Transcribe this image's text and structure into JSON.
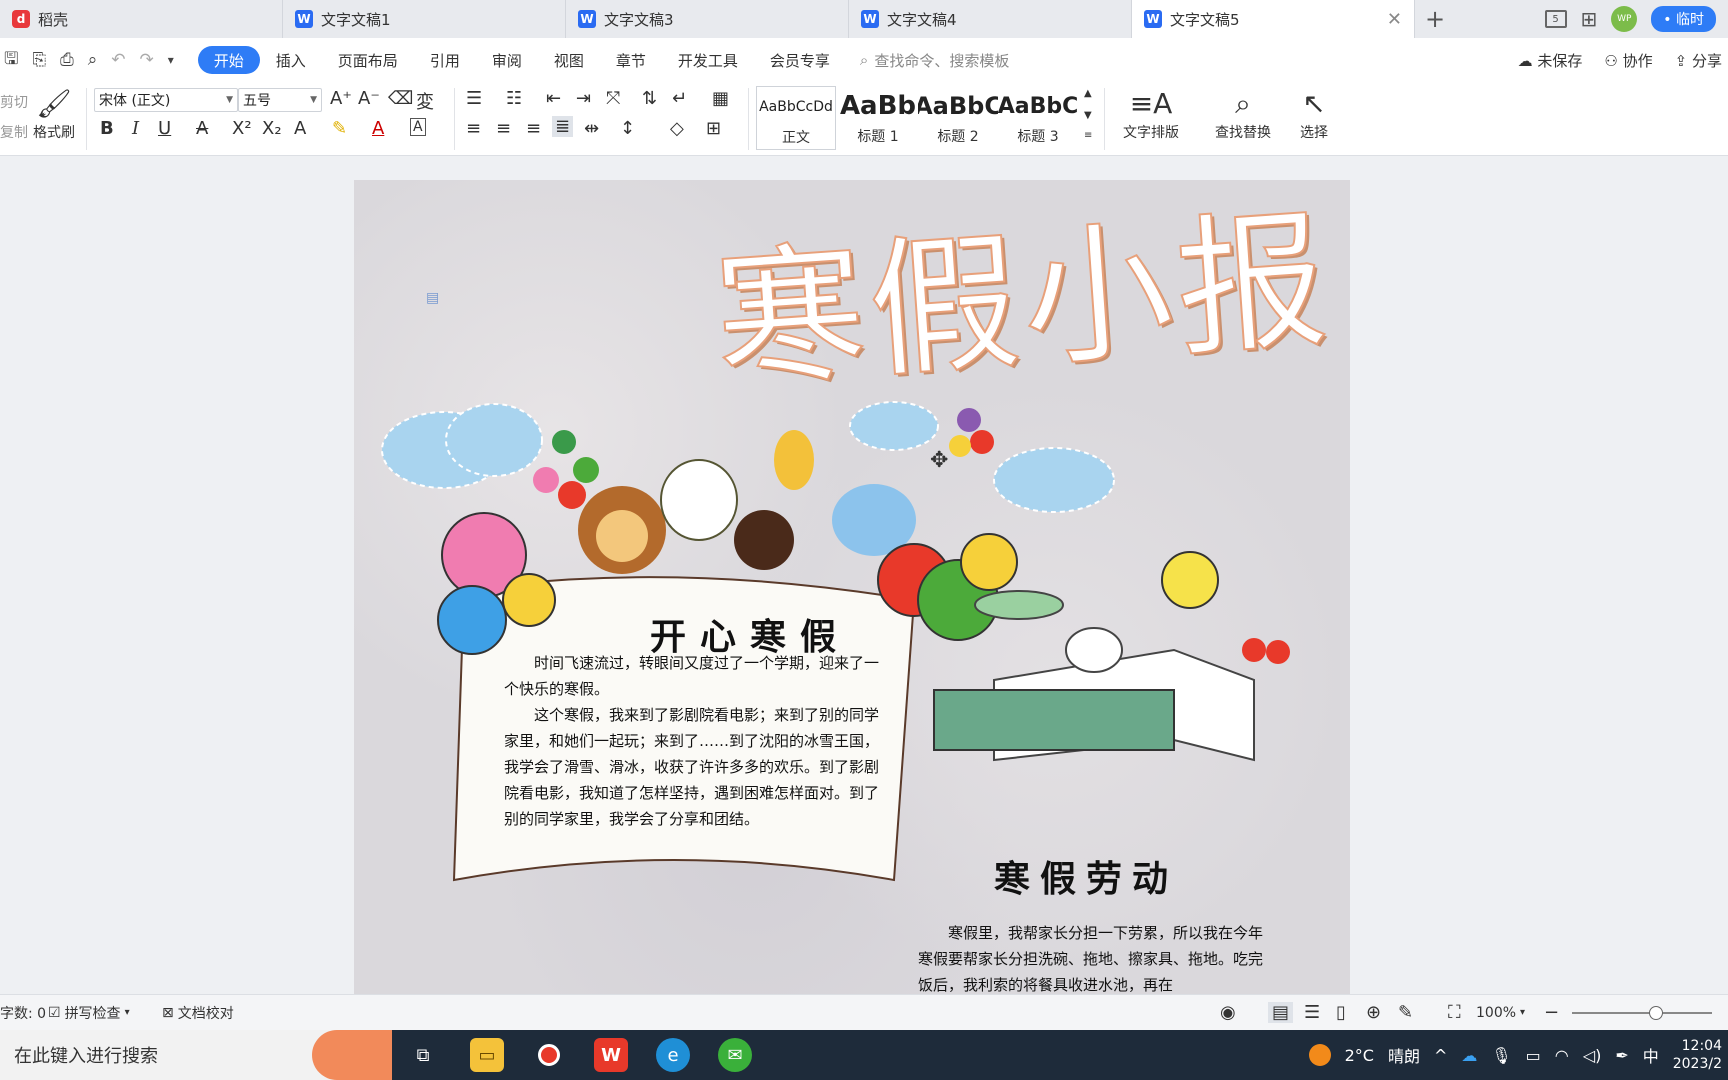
{
  "tabs": [
    {
      "label": "稻壳",
      "icon": "daoke-icon"
    },
    {
      "label": "文字文稿1",
      "icon": "wps-writer-icon"
    },
    {
      "label": "文字文稿3",
      "icon": "wps-writer-icon"
    },
    {
      "label": "文字文稿4",
      "icon": "wps-writer-icon"
    },
    {
      "label": "文字文稿5",
      "icon": "wps-writer-icon",
      "active": true
    }
  ],
  "titlebar": {
    "temp_label": "• 临时",
    "avatar_text": "WP",
    "box_label": "5"
  },
  "menu": {
    "items": [
      "开始",
      "插入",
      "页面布局",
      "引用",
      "审阅",
      "视图",
      "章节",
      "开发工具",
      "会员专享"
    ],
    "active": "开始",
    "search_placeholder": "查找命令、搜索模板",
    "unsaved": "未保存",
    "collab": "协作",
    "share": "分享"
  },
  "ribbon": {
    "cut": "剪切",
    "copy": "复制",
    "format_painter": "格式刷",
    "font_name": "宋体 (正文)",
    "font_size": "五号",
    "styles": [
      {
        "sample": "AaBbCcDd",
        "label": "正文"
      },
      {
        "sample": "AaBb",
        "label": "标题 1"
      },
      {
        "sample": "AaBbC",
        "label": "标题 2"
      },
      {
        "sample": "AaBbC",
        "label": "标题 3"
      }
    ],
    "text_layout": "文字排版",
    "find_replace": "查找替换",
    "select": "选择"
  },
  "document": {
    "title": "寒假小报",
    "section1_heading": "开心寒假",
    "section1_p1": "时间飞速流过，转眼间又度过了一个学期，迎来了一个快乐的寒假。",
    "section1_p2": "这个寒假，我来到了影剧院看电影；来到了别的同学家里，和她们一起玩；来到了……到了沈阳的冰雪王国，我学会了滑雪、滑冰，收获了许许多多的欢乐。到了影剧院看电影，我知道了怎样坚持，遇到困难怎样面对。到了别的同学家里，我学会了分享和团结。",
    "section2_heading": "寒假劳动",
    "section2_p1": "寒假里，我帮家长分担一下劳累，所以我在今年寒假要帮家长分担洗碗、拖地、擦家具、拖地。吃完饭后，我利索的将餐具收进水池，再在"
  },
  "status": {
    "word_count": "字数: 0",
    "spell_check": "拼写检查",
    "doc_check": "文档校对",
    "zoom": "100%",
    "zoom_level": 0.6
  },
  "taskbar": {
    "search_placeholder": "在此键入进行搜索",
    "weather_temp": "2°C",
    "weather_desc": "晴朗",
    "ime": "中",
    "time": "12:04",
    "date": "2023/2"
  },
  "colors": {
    "accent": "#2e7cf6",
    "title_stroke": "#e8a07a",
    "tab_bar": "#e8eaee",
    "taskbar": "#1e2b3a"
  }
}
